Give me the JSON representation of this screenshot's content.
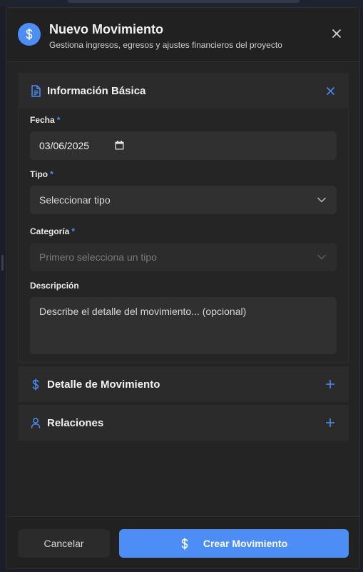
{
  "colors": {
    "accent": "#4c8df6",
    "background": "#1b1e26",
    "modal": "#242424",
    "section_header": "#2b2b2b",
    "field": "#303030"
  },
  "header": {
    "icon": "dollar-icon",
    "title": "Nuevo Movimiento",
    "subtitle": "Gestiona ingresos, egresos y ajustes financieros del proyecto",
    "close_icon": "close-icon"
  },
  "sections": {
    "basic": {
      "icon": "document-icon",
      "title": "Información Básica",
      "action_icon": "close-icon",
      "fields": {
        "fecha": {
          "label": "Fecha",
          "required_mark": "*",
          "value": "03/06/2025",
          "icon": "calendar-icon"
        },
        "tipo": {
          "label": "Tipo",
          "required_mark": "*",
          "placeholder": "Seleccionar tipo",
          "icon": "chevron-down-icon"
        },
        "categoria": {
          "label": "Categoría",
          "required_mark": "*",
          "placeholder": "Primero selecciona un tipo",
          "icon": "chevron-down-icon",
          "disabled": true
        },
        "descripcion": {
          "label": "Descripción",
          "placeholder": "Describe el detalle del movimiento... (opcional)"
        }
      }
    },
    "detalle": {
      "icon": "dollar-icon",
      "title": "Detalle de Movimiento",
      "action_icon": "plus-icon"
    },
    "relaciones": {
      "icon": "user-icon",
      "title": "Relaciones",
      "action_icon": "plus-icon"
    }
  },
  "footer": {
    "cancel_label": "Cancelar",
    "create_label": "Crear Movimiento",
    "create_icon": "dollar-icon"
  }
}
